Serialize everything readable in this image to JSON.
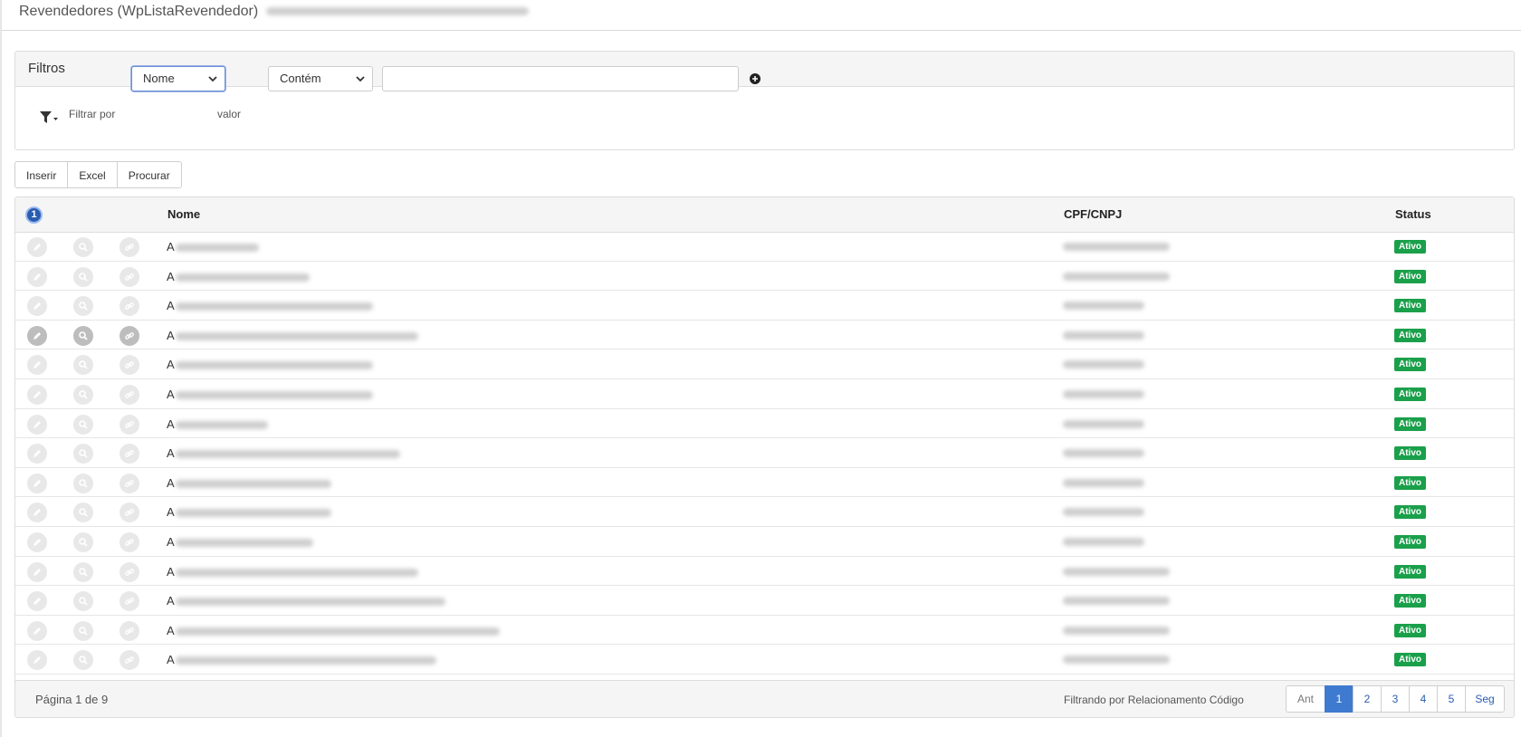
{
  "page": {
    "title": "Revendedores (WpListaRevendedor)"
  },
  "filters": {
    "panel_title": "Filtros",
    "filter_by_label": "Filtrar por",
    "field_select_value": "Nome",
    "value_label": "valor",
    "operator_select_value": "Contém",
    "search_value": ""
  },
  "toolbar": {
    "insert_label": "Inserir",
    "excel_label": "Excel",
    "search_label": "Procurar"
  },
  "grid": {
    "selection_badge": "1",
    "columns": {
      "name": "Nome",
      "cpf": "CPF/CNPJ",
      "status": "Status"
    },
    "rows": [
      {
        "initial": "A",
        "status": "Ativo"
      },
      {
        "initial": "A",
        "status": "Ativo"
      },
      {
        "initial": "A",
        "status": "Ativo"
      },
      {
        "initial": "A",
        "status": "Ativo"
      },
      {
        "initial": "A",
        "status": "Ativo"
      },
      {
        "initial": "A",
        "status": "Ativo"
      },
      {
        "initial": "A",
        "status": "Ativo"
      },
      {
        "initial": "A",
        "status": "Ativo"
      },
      {
        "initial": "A",
        "status": "Ativo"
      },
      {
        "initial": "A",
        "status": "Ativo"
      },
      {
        "initial": "A",
        "status": "Ativo"
      },
      {
        "initial": "A",
        "status": "Ativo"
      },
      {
        "initial": "A",
        "status": "Ativo"
      },
      {
        "initial": "A",
        "status": "Ativo"
      },
      {
        "initial": "A",
        "status": "Ativo"
      }
    ],
    "footer": {
      "page_info": "Página 1 de 9",
      "filter_info": "Filtrando por Relacionamento Código"
    },
    "pager": {
      "prev": "Ant",
      "pages": [
        "1",
        "2",
        "3",
        "4",
        "5"
      ],
      "next": "Seg"
    }
  },
  "colors": {
    "status_active": "#1aa04a",
    "pager_active": "#3f7ad1",
    "badge": "#2a5db0"
  }
}
